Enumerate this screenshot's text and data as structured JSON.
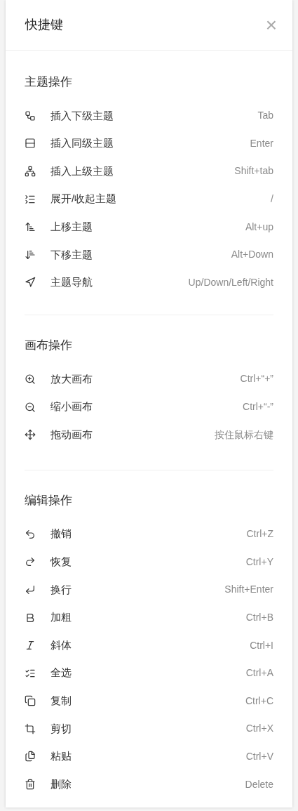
{
  "dialog": {
    "title": "快捷键",
    "close": "×"
  },
  "sections": [
    {
      "title": "主题操作",
      "items": [
        {
          "label": "插入下级主题",
          "shortcut": "Tab"
        },
        {
          "label": "插入同级主题",
          "shortcut": "Enter"
        },
        {
          "label": "插入上级主题",
          "shortcut": "Shift+tab"
        },
        {
          "label": "展开/收起主题",
          "shortcut": "/"
        },
        {
          "label": "上移主题",
          "shortcut": "Alt+up"
        },
        {
          "label": "下移主题",
          "shortcut": "Alt+Down"
        },
        {
          "label": "主题导航",
          "shortcut": "Up/Down/Left/Right"
        }
      ]
    },
    {
      "title": "画布操作",
      "items": [
        {
          "label": "放大画布",
          "shortcut": "Ctrl+“+”"
        },
        {
          "label": "缩小画布",
          "shortcut": "Ctrl+“-”"
        },
        {
          "label": "拖动画布",
          "shortcut": "按住鼠标右键"
        }
      ]
    },
    {
      "title": "编辑操作",
      "items": [
        {
          "label": "撤销",
          "shortcut": "Ctrl+Z"
        },
        {
          "label": "恢复",
          "shortcut": "Ctrl+Y"
        },
        {
          "label": "换行",
          "shortcut": "Shift+Enter"
        },
        {
          "label": "加粗",
          "shortcut": "Ctrl+B"
        },
        {
          "label": "斜体",
          "shortcut": "Ctrl+I"
        },
        {
          "label": "全选",
          "shortcut": "Ctrl+A"
        },
        {
          "label": "复制",
          "shortcut": "Ctrl+C"
        },
        {
          "label": "剪切",
          "shortcut": "Ctrl+X"
        },
        {
          "label": "粘贴",
          "shortcut": "Ctrl+V"
        },
        {
          "label": "删除",
          "shortcut": "Delete"
        }
      ]
    }
  ]
}
